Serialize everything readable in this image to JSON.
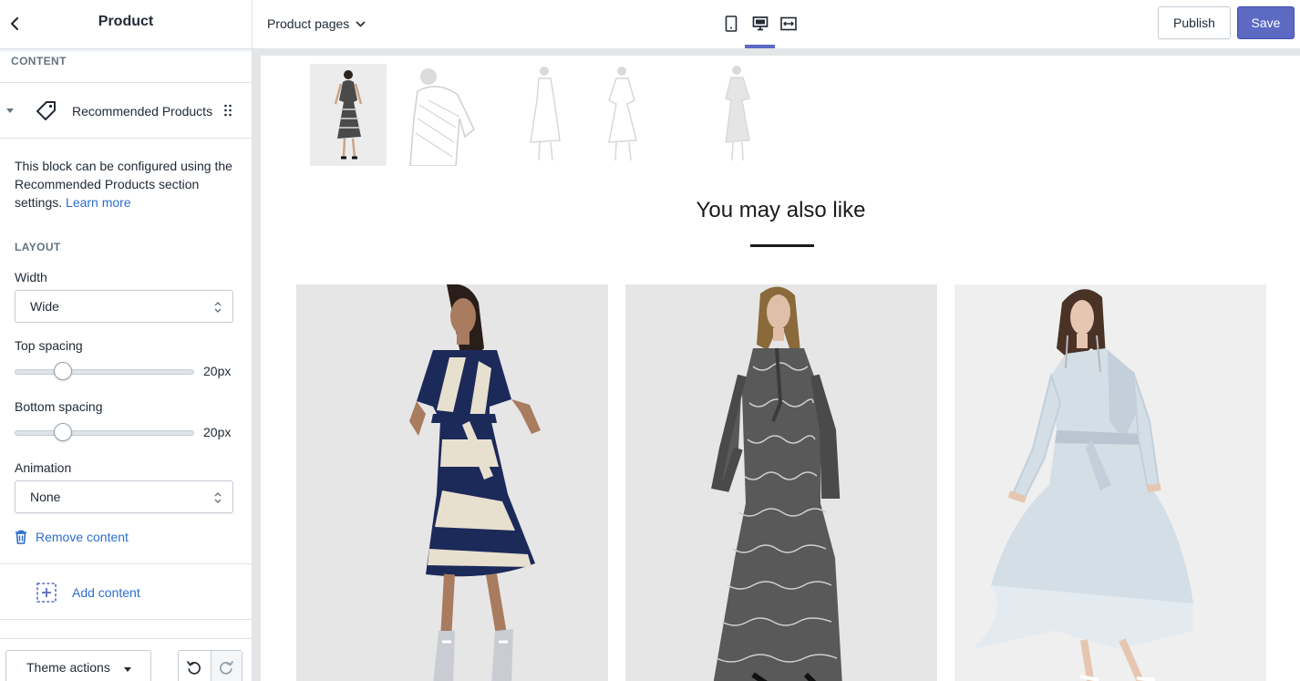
{
  "sidebar": {
    "title": "Product",
    "content_label": "CONTENT",
    "block": {
      "name": "Recommended Products"
    },
    "description": "This block can be configured using the Recommended Products section settings.",
    "learn_more": "Learn more",
    "layout_label": "LAYOUT",
    "width": {
      "label": "Width",
      "value": "Wide"
    },
    "top_spacing": {
      "label": "Top spacing",
      "value": "20px",
      "fraction": 0.27
    },
    "bottom_spacing": {
      "label": "Bottom spacing",
      "value": "20px",
      "fraction": 0.27
    },
    "animation": {
      "label": "Animation",
      "value": "None"
    },
    "remove_content": "Remove content",
    "add_content": "Add content",
    "theme_actions": "Theme actions"
  },
  "topbar": {
    "page_selector": "Product pages",
    "devices": [
      "mobile",
      "desktop",
      "fullscreen"
    ],
    "active_device": "desktop",
    "publish_label": "Publish",
    "save_label": "Save"
  },
  "preview": {
    "heading": "You may also like",
    "thumbnails": [
      "dress-1",
      "dress-2",
      "dress-3",
      "dress-4",
      "dress-5"
    ],
    "active_thumbnail": 0,
    "products": [
      {
        "image": "navy-cream-striped-dress"
      },
      {
        "image": "snakeskin-print-maxi-dress"
      },
      {
        "image": "light-blue-ruffle-dress"
      }
    ]
  },
  "colors": {
    "accent": "#5c6ac4",
    "link": "#2c6ecb",
    "border": "#c4cdd5",
    "text": "#212b36",
    "subdued": "#637381"
  }
}
